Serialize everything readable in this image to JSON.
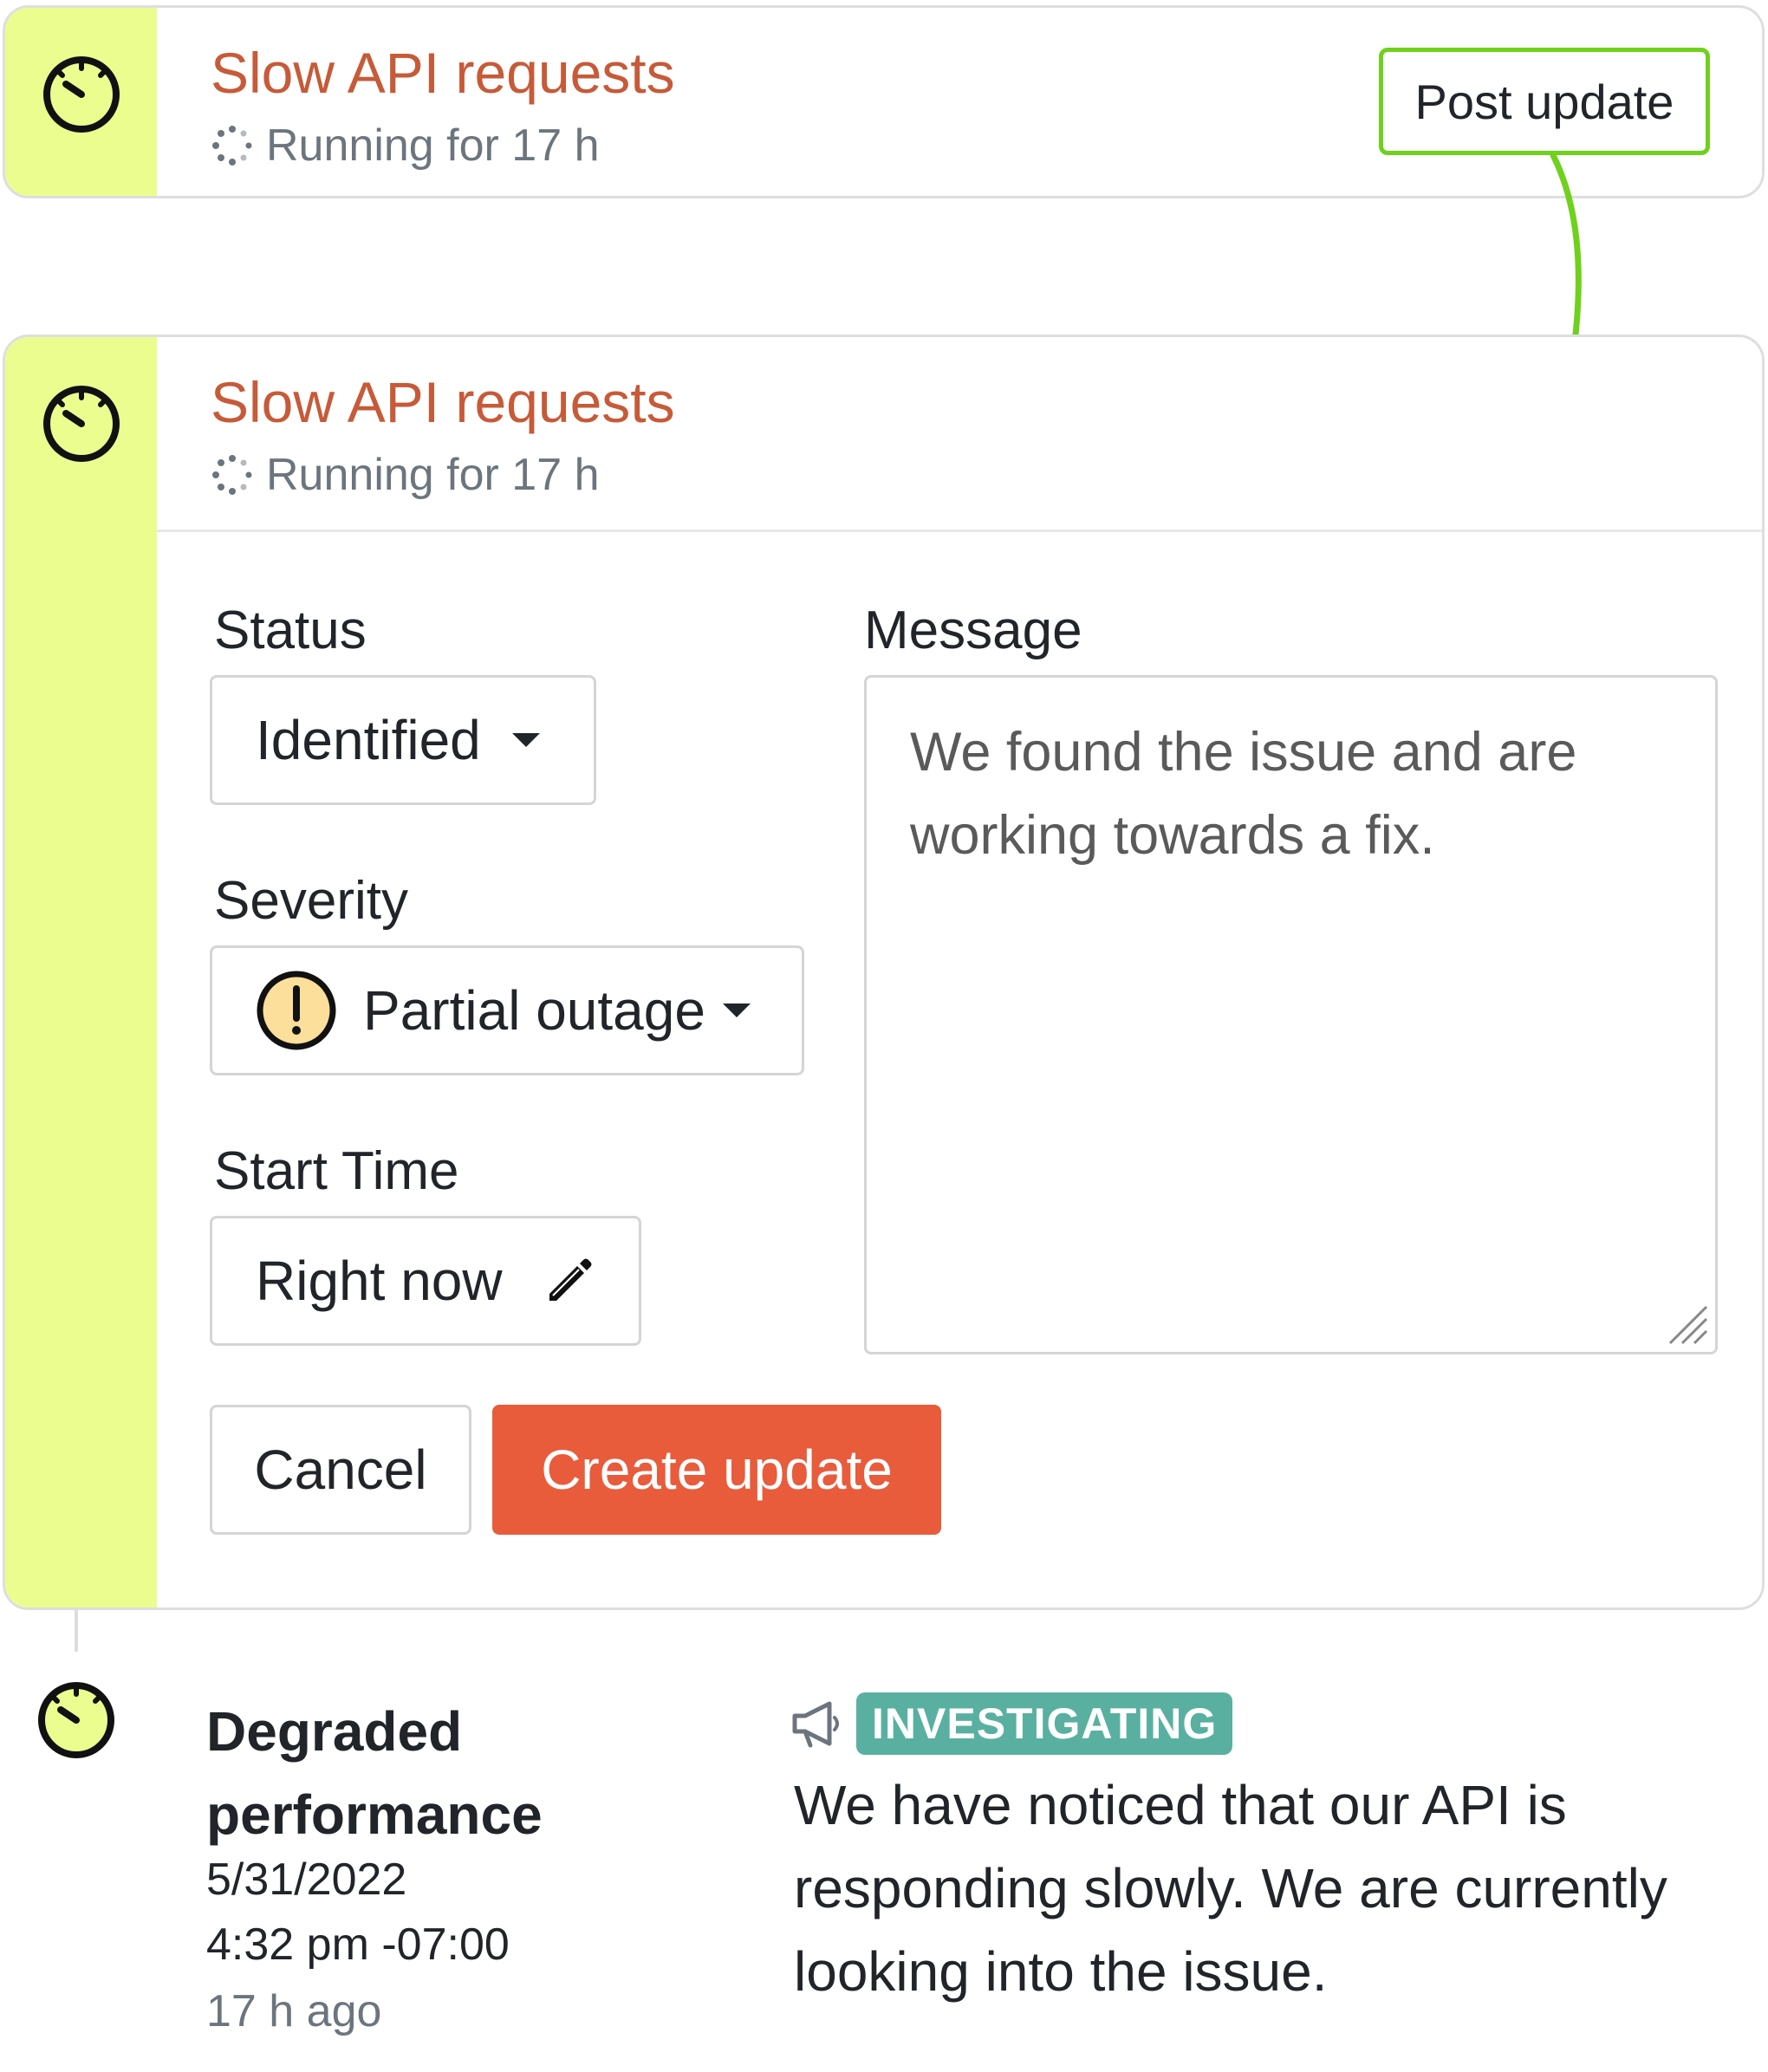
{
  "top_card": {
    "title": "Slow API requests",
    "running": "Running for 17 h",
    "icon": "stopwatch-icon",
    "post_update_label": "Post update"
  },
  "expanded_card": {
    "title": "Slow API requests",
    "running": "Running for 17 h",
    "icon": "stopwatch-icon"
  },
  "form": {
    "status_label": "Status",
    "status_value": "Identified",
    "severity_label": "Severity",
    "severity_value": "Partial outage",
    "severity_icon": "warning-icon",
    "start_time_label": "Start Time",
    "start_time_value": "Right now",
    "message_label": "Message",
    "message_value": "We found the issue and are working towards a fix.",
    "cancel_label": "Cancel",
    "create_label": "Create update"
  },
  "timeline": {
    "title": "Degraded performance",
    "date": "5/31/2022",
    "time": "4:32 pm -07:00",
    "ago": "17 h ago",
    "badge": "INVESTIGATING",
    "message": "We have noticed that our API is responding slowly. We are currently looking into the issue."
  },
  "colors": {
    "stripe": "#ebfd8f",
    "title": "#c75a38",
    "accent_green": "#6fd11c",
    "primary": "#e85c3c",
    "badge": "#5ab0a0"
  }
}
